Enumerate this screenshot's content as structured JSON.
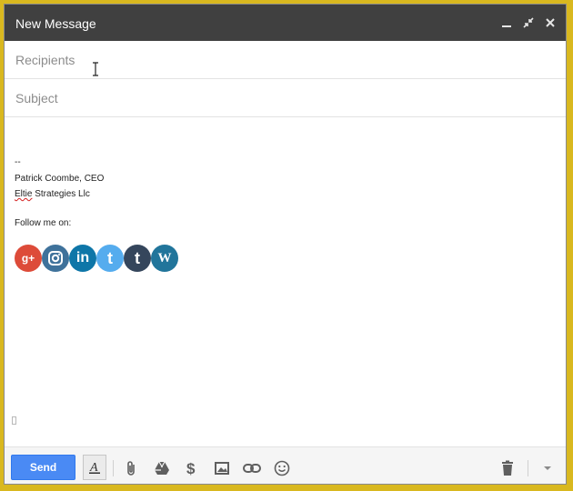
{
  "window": {
    "title": "New Message"
  },
  "recipients": {
    "placeholder": "Recipients",
    "value": ""
  },
  "subject": {
    "placeholder": "Subject",
    "value": ""
  },
  "signature": {
    "dash": "--",
    "name_line": "Patrick Coombe, CEO",
    "company_first": "Eltie",
    "company_rest": " Strategies Llc",
    "follow_line": "Follow me on:"
  },
  "social_icons": [
    {
      "icon": "google-plus-icon",
      "glyph": "g+",
      "color": "#dd4b39"
    },
    {
      "icon": "instagram-icon",
      "glyph": "◘",
      "color": "#3f729b"
    },
    {
      "icon": "linkedin-icon",
      "glyph": "in",
      "color": "#0e76a8"
    },
    {
      "icon": "twitter-icon",
      "glyph": "t",
      "color": "#55acee"
    },
    {
      "icon": "tumblr-icon",
      "glyph": "t",
      "color": "#35465c"
    },
    {
      "icon": "wordpress-icon",
      "glyph": "W",
      "color": "#21759b"
    }
  ],
  "toolbar": {
    "send_label": "Send",
    "icons": [
      "formatting-icon",
      "attach-icon",
      "drive-icon",
      "money-icon",
      "photo-icon",
      "link-icon",
      "emoji-icon",
      "trash-icon",
      "more-options-icon"
    ]
  },
  "colors": {
    "titlebar": "#404040",
    "send_button": "#4a8af4",
    "outer_border": "#d9b81f"
  }
}
